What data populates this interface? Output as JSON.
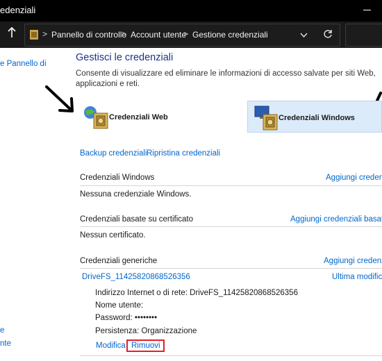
{
  "window": {
    "title": "edenziali"
  },
  "address": {
    "crumbs": [
      "Pannello di controllo",
      "Account utente",
      "Gestione credenziali"
    ],
    "separator": ">"
  },
  "sidebar": {
    "links": [
      "e Pannello di",
      "e",
      "nte"
    ]
  },
  "main": {
    "title": "Gestisci le credenziali",
    "description": "Consente di visualizzare ed eliminare le informazioni di accesso salvate per siti Web, applicazioni e reti.",
    "categories": [
      {
        "label": "Credenziali Web",
        "selected": false
      },
      {
        "label": "Credenziali Windows",
        "selected": true
      }
    ],
    "actions": {
      "backup": "Backup credenziali",
      "restore": "Ripristina credenziali"
    },
    "sections": {
      "windows": {
        "header": "Credenziali Windows",
        "add": "Aggiungi credenz",
        "empty": "Nessuna credenziale Windows."
      },
      "certificate": {
        "header": "Credenziali basate su certificato",
        "add": "Aggiungi credenziali basate",
        "empty": "Nessun certificato."
      },
      "generic": {
        "header": "Credenziali generiche",
        "add": "Aggiungi credenz",
        "item": {
          "name": "DriveFS_11425820868526356",
          "modified": "Ultima modifica",
          "address_label": "Indirizzo Internet o di rete:",
          "address_value": "DriveFS_11425820868526356",
          "username_label": "Nome utente:",
          "password_label": "Password:",
          "password_value": "••••••••",
          "persistence_label": "Persistenza:",
          "persistence_value": "Organizzazione",
          "edit": "Modifica",
          "remove": "Rimuovi"
        }
      }
    }
  },
  "colors": {
    "accent_link": "#0066cc",
    "title_blue": "#1e3287",
    "highlight": "#e0202e",
    "selected_bg": "#dcebfa"
  }
}
